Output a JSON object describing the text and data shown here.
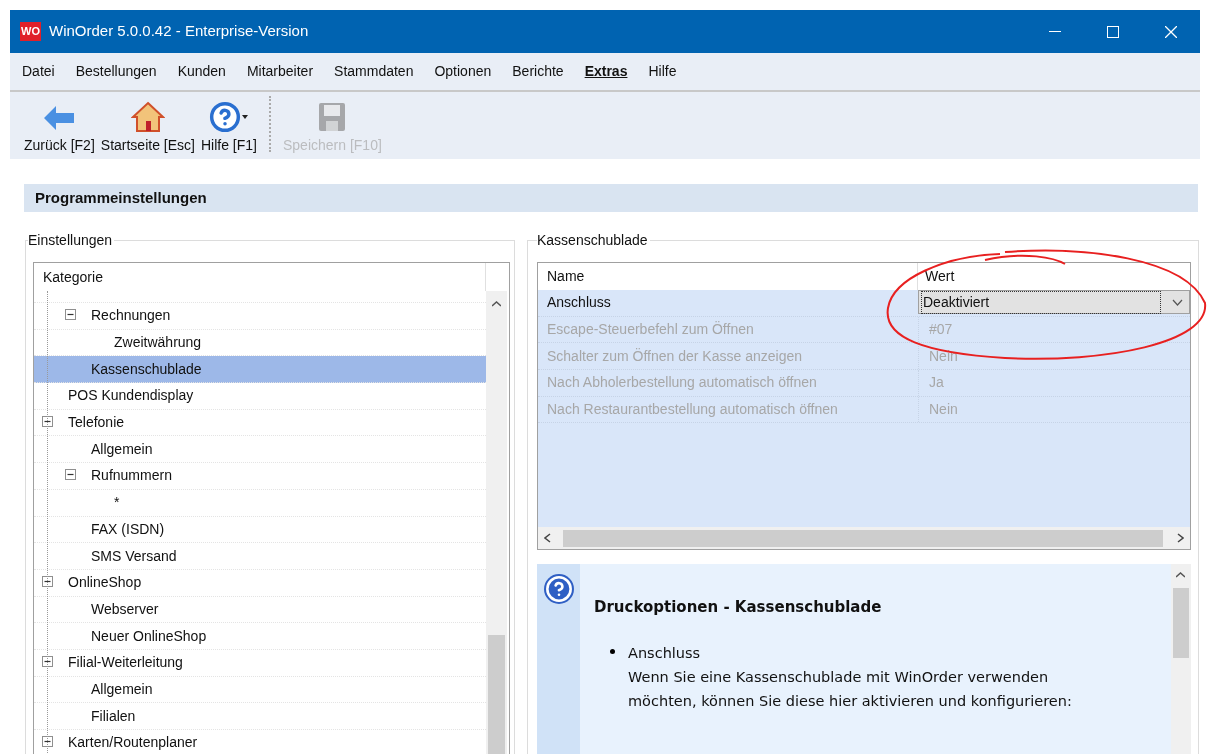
{
  "window": {
    "title": "WinOrder 5.0.0.42 - Enterprise-Version",
    "logo": "WO"
  },
  "menu": [
    {
      "label": "Datei",
      "selected": false
    },
    {
      "label": "Bestellungen",
      "selected": false
    },
    {
      "label": "Kunden",
      "selected": false
    },
    {
      "label": "Mitarbeiter",
      "selected": false
    },
    {
      "label": "Stammdaten",
      "selected": false
    },
    {
      "label": "Optionen",
      "selected": false
    },
    {
      "label": "Berichte",
      "selected": false
    },
    {
      "label": "Extras",
      "selected": true
    },
    {
      "label": "Hilfe",
      "selected": false
    }
  ],
  "toolbar": [
    {
      "kind": "back",
      "label": "Zurück [F2]",
      "disabled": false
    },
    {
      "kind": "home",
      "label": "Startseite [Esc]",
      "disabled": false
    },
    {
      "kind": "help",
      "label": "Hilfe [F1]",
      "disabled": false
    },
    {
      "kind": "save",
      "label": "Speichern [F10]",
      "disabled": true
    }
  ],
  "page_title": "Programmeinstellungen",
  "settings": {
    "title": "Einstellungen",
    "column": "Kategorie",
    "continued_children": [
      {
        "label": "Rechnungen",
        "selected": false,
        "expanded": true,
        "children": [
          {
            "label": "Zweitwährung",
            "selected": false
          }
        ]
      },
      {
        "label": "Kassenschublade",
        "selected": true
      }
    ],
    "items": [
      {
        "label": "POS Kundendisplay",
        "selected": false
      },
      {
        "label": "Telefonie",
        "selected": false,
        "expanded": true,
        "children": [
          {
            "label": "Allgemein",
            "selected": false
          },
          {
            "label": "Rufnummern",
            "selected": false,
            "expanded": true,
            "children": [
              {
                "label": "*",
                "selected": false
              }
            ]
          },
          {
            "label": "FAX (ISDN)",
            "selected": false
          },
          {
            "label": "SMS Versand",
            "selected": false
          }
        ]
      },
      {
        "label": "OnlineShop",
        "selected": false,
        "expanded": true,
        "children": [
          {
            "label": "Webserver",
            "selected": false
          },
          {
            "label": "Neuer OnlineShop",
            "selected": false
          }
        ]
      },
      {
        "label": "Filial-Weiterleitung",
        "selected": false,
        "expanded": true,
        "children": [
          {
            "label": "Allgemein",
            "selected": false
          },
          {
            "label": "Filialen",
            "selected": false
          }
        ]
      },
      {
        "label": "Karten/Routenplaner",
        "selected": false,
        "expanded": true
      }
    ]
  },
  "properties": {
    "title": "Kassenschublade",
    "columns": [
      "Name",
      "Wert"
    ],
    "rows": [
      {
        "name": "Anschluss",
        "value": "Deaktiviert",
        "kind": "dropdown",
        "disabled": false
      },
      {
        "name": "Escape-Steuerbefehl zum Öffnen",
        "value": "#07",
        "kind": "text",
        "disabled": true
      },
      {
        "name": "Schalter zum Öffnen der Kasse anzeigen",
        "value": "Nein",
        "kind": "text",
        "disabled": true
      },
      {
        "name": "Nach Abholerbestellung automatisch öffnen",
        "value": "Ja",
        "kind": "text",
        "disabled": true
      },
      {
        "name": "Nach Restaurantbestellung automatisch öffnen",
        "value": "Nein",
        "kind": "text",
        "disabled": true
      }
    ]
  },
  "help": {
    "heading": "Druckoptionen - Kassenschublade",
    "items": [
      {
        "title": "Anschluss",
        "text": "Wenn Sie eine Kassenschublade mit WinOrder verwenden möchten, können Sie diese hier aktivieren und konfigurieren:"
      }
    ]
  }
}
